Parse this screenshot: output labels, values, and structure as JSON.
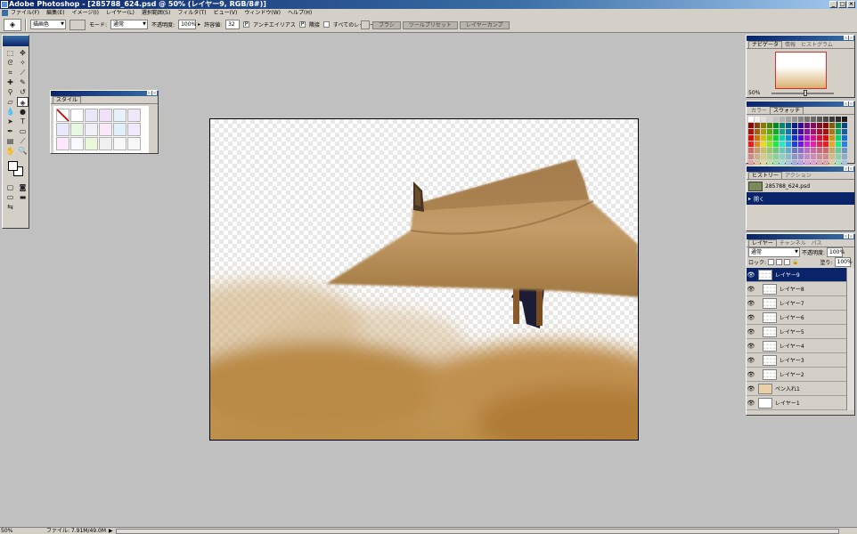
{
  "window": {
    "title": "Adobe Photoshop - [285788_624.psd @ 50% (レイヤー9, RGB/8#)]",
    "controls": [
      "_",
      "□",
      "×"
    ]
  },
  "menu": [
    "ファイル(F)",
    "編集(E)",
    "イメージ(I)",
    "レイヤー(L)",
    "選択範囲(S)",
    "フィルタ(T)",
    "ビュー(V)",
    "ウィンドウ(W)",
    "ヘルプ(H)"
  ],
  "options": {
    "fill_select": "描画色",
    "mode_label": "モード:",
    "mode_value": "通常",
    "opacity_label": "不透明度:",
    "opacity_value": "100%",
    "tolerance_label": "許容値:",
    "tolerance_value": "32",
    "antialias_label": "アンチエイリアス",
    "contiguous_label": "隣接",
    "all_layers_label": "すべてのレイヤー",
    "antialias_checked": "P",
    "contiguous_checked": "P",
    "all_layers_checked": "",
    "wells": [
      "ブラシ",
      "ツールプリセット",
      "レイヤーカンプ"
    ]
  },
  "style_palette": {
    "tab": "スタイル"
  },
  "navigator": {
    "tabs": [
      "ナビゲータ",
      "情報",
      "ヒストグラム"
    ],
    "zoom": "50%"
  },
  "swatches": {
    "tabs": [
      "カラー",
      "スウォッチ"
    ]
  },
  "history": {
    "tabs": [
      "ヒストリー",
      "アクション"
    ],
    "snapshot": "285788_624.psd",
    "state": "開く"
  },
  "layers": {
    "tabs": [
      "レイヤー",
      "チャンネル",
      "パス"
    ],
    "blend": "通常",
    "opacity_label": "不透明度:",
    "opacity": "100%",
    "lock_label": "ロック:",
    "fill_label": "塗り:",
    "fill": "100%",
    "items": [
      {
        "name": "レイヤー9",
        "selected": true
      },
      {
        "name": "レイヤー8",
        "selected": false
      },
      {
        "name": "レイヤー7",
        "selected": false
      },
      {
        "name": "レイヤー6",
        "selected": false
      },
      {
        "name": "レイヤー5",
        "selected": false
      },
      {
        "name": "レイヤー4",
        "selected": false
      },
      {
        "name": "レイヤー3",
        "selected": false
      },
      {
        "name": "レイヤー2",
        "selected": false
      },
      {
        "name": "ペン入れ1",
        "selected": false
      },
      {
        "name": "レイヤー1",
        "selected": false
      }
    ]
  },
  "status": {
    "zoom": "50%",
    "info": "ファイル: 7.91M/49.0M",
    "arrow": "▶"
  }
}
